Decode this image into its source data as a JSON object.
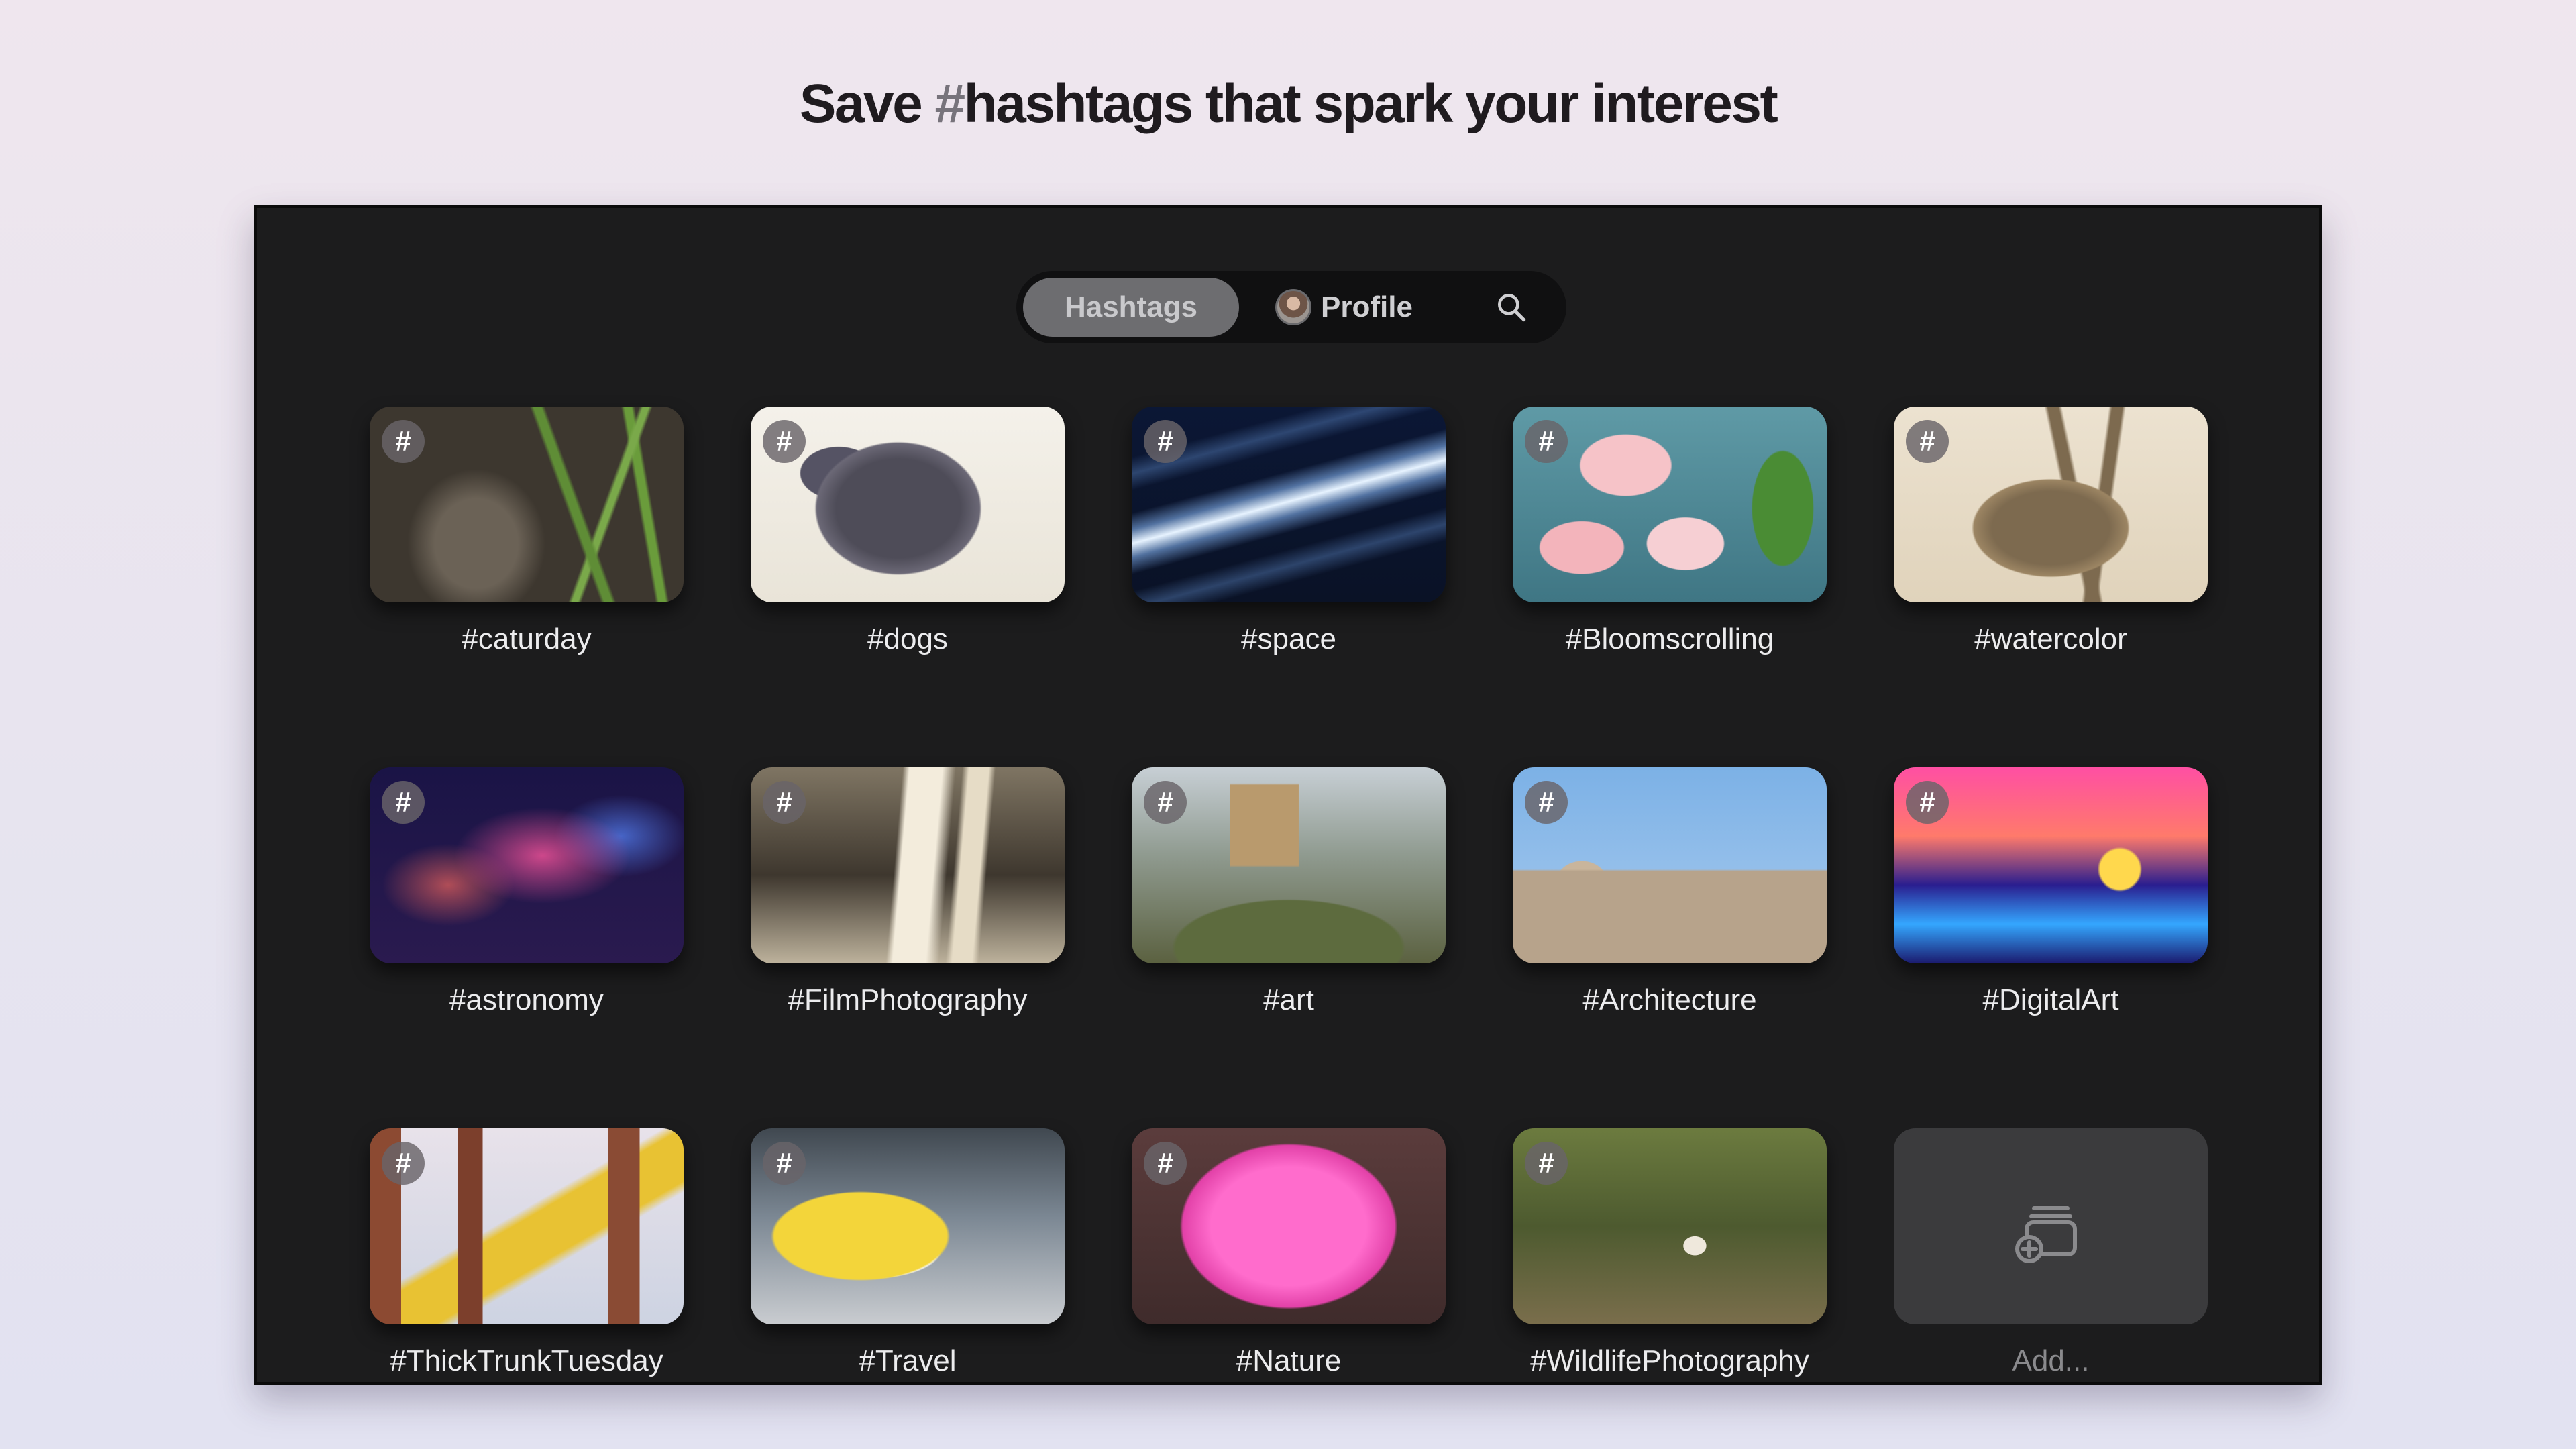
{
  "headline": {
    "before": "Save ",
    "hash": "#",
    "after": "hashtags that spark your interest"
  },
  "tabs": {
    "hashtags": "Hashtags",
    "profile": "Profile"
  },
  "icons": {
    "search": "search-icon",
    "add": "add-collection-icon",
    "badge_text": "#"
  },
  "colors": {
    "background": "#1c1c1d",
    "active_tab": "#6d6d70",
    "add_card": "#3b3b3d"
  },
  "tiles": [
    {
      "label": "#caturday"
    },
    {
      "label": "#dogs"
    },
    {
      "label": "#space"
    },
    {
      "label": "#Bloomscrolling"
    },
    {
      "label": "#watercolor"
    },
    {
      "label": "#astronomy"
    },
    {
      "label": "#FilmPhotography"
    },
    {
      "label": "#art"
    },
    {
      "label": "#Architecture"
    },
    {
      "label": "#DigitalArt"
    },
    {
      "label": "#ThickTrunkTuesday"
    },
    {
      "label": "#Travel"
    },
    {
      "label": "#Nature"
    },
    {
      "label": "#WildlifePhotography"
    }
  ],
  "add_tile": {
    "label": "Add..."
  }
}
